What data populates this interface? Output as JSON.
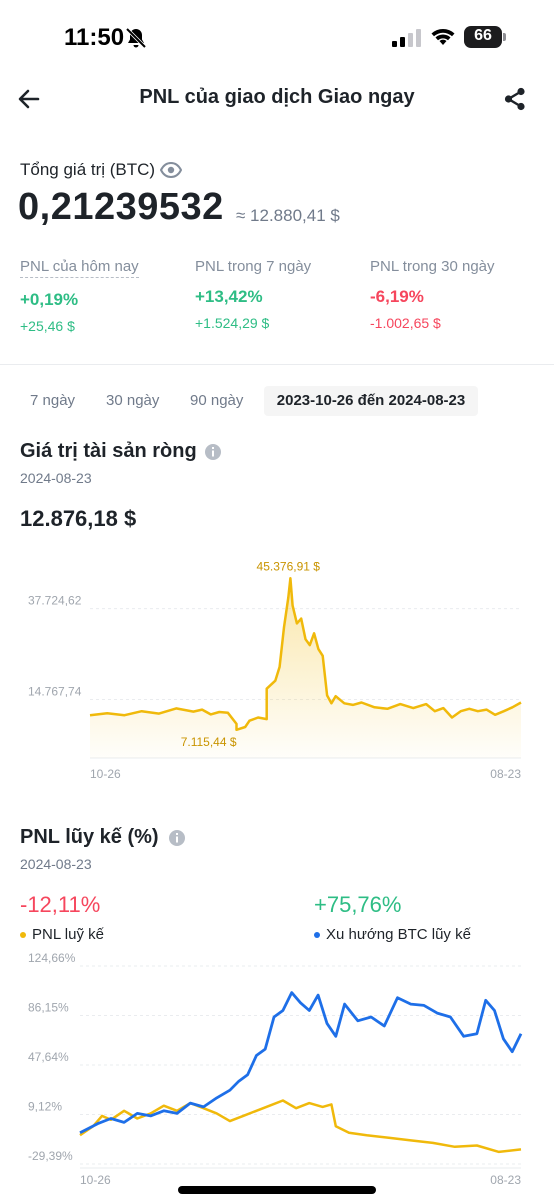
{
  "status_bar": {
    "time": "11:50",
    "battery": "66"
  },
  "header": {
    "title": "PNL của giao dịch Giao ngay"
  },
  "summary": {
    "label": "Tổng giá trị (BTC)",
    "value": "0,21239532",
    "approx": "≈ 12.880,41 $"
  },
  "pnl_periods": [
    {
      "label": "PNL của hôm nay",
      "pct": "+0,19%",
      "amount": "+25,46 $",
      "status": "positive"
    },
    {
      "label": "PNL trong 7 ngày",
      "pct": "+13,42%",
      "amount": "+1.524,29 $",
      "status": "positive"
    },
    {
      "label": "PNL trong 30 ngày",
      "pct": "-6,19%",
      "amount": "-1.002,65 $",
      "status": "negative"
    }
  ],
  "range_tabs": [
    {
      "label": "7 ngày",
      "active": false
    },
    {
      "label": "30 ngày",
      "active": false
    },
    {
      "label": "90 ngày",
      "active": false
    },
    {
      "label": "2023-10-26 đến 2024-08-23",
      "active": true
    }
  ],
  "net_value_section": {
    "title": "Giá trị tài sản ròng",
    "date": "2024-08-23",
    "value": "12.876,18 $"
  },
  "cumulative_section": {
    "title": "PNL lũy kế (%)",
    "date": "2024-08-23",
    "pnl_value": "-12,11%",
    "btc_value": "+75,76%",
    "legend": {
      "pnl": "PNL luỹ kế",
      "btc": "Xu hướng BTC lũy kế"
    }
  },
  "colors": {
    "gold": "#f0b90b",
    "blue": "#1e6fe8",
    "green": "#2ebd85",
    "red": "#f6465d"
  },
  "chart_data": [
    {
      "type": "area",
      "title": "Giá trị tài sản ròng",
      "x_tick_labels": [
        "10-26",
        "08-23"
      ],
      "y_tick_labels": [
        "37.724,62",
        "14.767,74"
      ],
      "yticks": [
        37724.62,
        14767.74
      ],
      "ylim": [
        2000,
        49000
      ],
      "annotations": [
        {
          "text": "45.376,91 $",
          "x": 0.46,
          "y": 45376.91
        },
        {
          "text": "7.115,44 $",
          "x": 0.34,
          "y": 7115.44
        }
      ],
      "series": [
        {
          "color": "#f0b90b",
          "x": [
            0,
            0.04,
            0.08,
            0.12,
            0.16,
            0.2,
            0.24,
            0.26,
            0.28,
            0.3,
            0.32,
            0.34,
            0.34,
            0.36,
            0.37,
            0.39,
            0.41,
            0.41,
            0.43,
            0.44,
            0.45,
            0.46,
            0.465,
            0.47,
            0.48,
            0.49,
            0.5,
            0.51,
            0.52,
            0.53,
            0.54,
            0.55,
            0.56,
            0.57,
            0.59,
            0.61,
            0.63,
            0.66,
            0.69,
            0.72,
            0.75,
            0.78,
            0.8,
            0.82,
            0.84,
            0.86,
            0.88,
            0.9,
            0.92,
            0.94,
            0.96,
            0.98,
            1.0
          ],
          "y": [
            10800,
            11300,
            10800,
            11800,
            11200,
            12500,
            11700,
            12200,
            11000,
            11600,
            11400,
            8600,
            7100,
            7800,
            9400,
            10200,
            9800,
            17500,
            19500,
            23000,
            33000,
            40500,
            45376.91,
            38500,
            34000,
            35200,
            30000,
            28500,
            31500,
            27500,
            25800,
            15800,
            13800,
            15600,
            13800,
            13400,
            14000,
            12800,
            12400,
            13600,
            12600,
            13600,
            11800,
            12600,
            10200,
            11800,
            12400,
            11800,
            12200,
            10900,
            11800,
            12800,
            14000
          ]
        }
      ]
    },
    {
      "type": "line",
      "title": "PNL lũy kế (%)",
      "x_tick_labels": [
        "10-26",
        "08-23"
      ],
      "y_tick_labels": [
        "124,66%",
        "86,15%",
        "47,64%",
        "9,12%",
        "-29,39%"
      ],
      "yticks": [
        124.66,
        86.15,
        47.64,
        9.12,
        -29.39
      ],
      "ylim": [
        -29.39,
        124.66
      ],
      "series": [
        {
          "name": "PNL luỹ kế",
          "color": "#f0b90b",
          "x": [
            0,
            0.03,
            0.05,
            0.07,
            0.1,
            0.13,
            0.16,
            0.19,
            0.22,
            0.25,
            0.28,
            0.31,
            0.34,
            0.37,
            0.4,
            0.43,
            0.46,
            0.49,
            0.52,
            0.55,
            0.57,
            0.58,
            0.61,
            0.65,
            0.7,
            0.75,
            0.8,
            0.85,
            0.9,
            0.95,
            1.0
          ],
          "y": [
            -7,
            0,
            8,
            5,
            12,
            6,
            10,
            16,
            12,
            18,
            14,
            10,
            4,
            8,
            12,
            16,
            20,
            14,
            18,
            15,
            17,
            0,
            -5,
            -7,
            -9,
            -11,
            -13,
            -16,
            -15,
            -20,
            -18
          ]
        },
        {
          "name": "Xu hướng BTC lũy kế",
          "color": "#1e6fe8",
          "x": [
            0,
            0.04,
            0.07,
            0.1,
            0.13,
            0.16,
            0.19,
            0.22,
            0.25,
            0.28,
            0.31,
            0.34,
            0.36,
            0.38,
            0.4,
            0.42,
            0.44,
            0.46,
            0.48,
            0.5,
            0.52,
            0.54,
            0.56,
            0.58,
            0.6,
            0.63,
            0.66,
            0.69,
            0.72,
            0.75,
            0.78,
            0.81,
            0.84,
            0.87,
            0.9,
            0.92,
            0.94,
            0.96,
            0.98,
            1.0
          ],
          "y": [
            -5,
            2,
            6,
            3,
            10,
            8,
            12,
            10,
            18,
            15,
            22,
            28,
            35,
            40,
            55,
            60,
            85,
            90,
            104,
            96,
            90,
            102,
            80,
            70,
            95,
            82,
            85,
            78,
            100,
            95,
            94,
            88,
            85,
            70,
            72,
            98,
            90,
            68,
            58,
            72
          ]
        }
      ]
    }
  ]
}
